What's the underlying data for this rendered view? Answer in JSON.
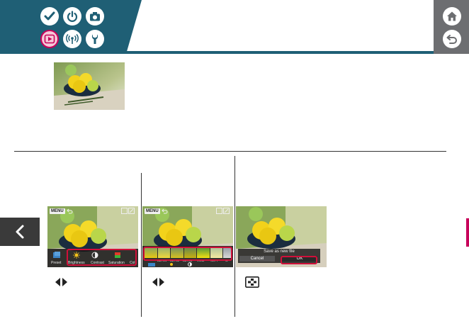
{
  "header": {
    "nav_icons": [
      "checkmark-icon",
      "power-icon",
      "camera-icon",
      "playback-icon",
      "wireless-icon",
      "wrench-icon"
    ],
    "active_icon": "playback-icon",
    "side_icons": [
      "home-icon",
      "return-icon"
    ]
  },
  "colors": {
    "brand": "#1f5f75",
    "accent": "#c7005a",
    "side_panel": "#6d6e71"
  },
  "screens": {
    "adjust": {
      "menu_label": "MENU",
      "preset_label": "Preset",
      "params": [
        "Brightness",
        "Contrast",
        "Saturation",
        "Col"
      ]
    },
    "presets": {
      "menu_label": "MENU",
      "filters": [
        "",
        "AUTO1",
        "AUTO2",
        "AUTO3",
        "VIVID",
        "SOFT",
        "W"
      ]
    },
    "save": {
      "title": "Save as new file",
      "cancel": "Cancel",
      "ok": "OK"
    }
  }
}
